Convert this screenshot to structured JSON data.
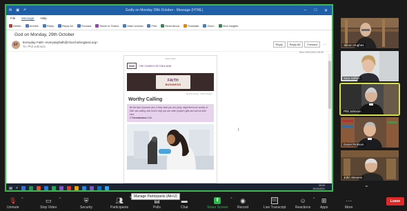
{
  "outlook": {
    "title": "Godly on Monday 29th October - Message (HTML)",
    "menu": [
      "File",
      "Message",
      "Help"
    ],
    "active_menu": "Message",
    "ribbon": [
      "Delete",
      "Archive",
      "Reply",
      "Reply All",
      "Forward",
      "Share to Teams",
      "Mark Unread",
      "Find",
      "Read Aloud",
      "Translate",
      "Zoom",
      "Viva Insights"
    ],
    "subject": "God on Monday, 29th October",
    "sender": {
      "initials": "EF",
      "name": "Everyday Faith <everydayfaith@churchofengland.org>",
      "to": "To: Phil Johnson"
    },
    "reply_buttons": [
      "Reply",
      "Reply All",
      "Forward"
    ],
    "date": "Mon 29/10/2021 06:00"
  },
  "newsletter": {
    "top": "View online",
    "logo_small": "faith",
    "logo_org": "THE CHURCH OF ENGLAND",
    "banner": {
      "line1": "FAITH",
      "line2": "BUSINESS"
    },
    "meta": "By Eve Poole · 29th October",
    "heading": "Worthy Calling",
    "purple_text": "Be the kind of person who, if they meet you at a party, might feel more worthy of their own calling. Ask God to help you see other people's gifts and call out their best.",
    "verse": "1 Thessalonians 1:11"
  },
  "cursor_mark": "I",
  "taskbar": {
    "clock_time": "06:00",
    "clock_date": "29/10/2021",
    "icon_colors": [
      "#3c6ecf",
      "#2e8b57",
      "#e05030",
      "#2b7bd4",
      "#23a455",
      "#8552c7",
      "#d83b3b",
      "#f0a000",
      "#1e88e5",
      "#7a56c8",
      "#0b6fc2",
      "#2ea3f2"
    ]
  },
  "participants": [
    {
      "name": "Simon Hughes",
      "active": false
    },
    {
      "name": "Sara Sefton",
      "active": false
    },
    {
      "name": "Phil Johnson",
      "active": true
    },
    {
      "name": "Daniel Robson",
      "active": false
    },
    {
      "name": "John Stevens",
      "active": false
    }
  ],
  "toolbar": {
    "items": [
      {
        "label": "Unmute",
        "icon": "microphone-icon"
      },
      {
        "label": "Stop Video",
        "icon": "video-icon"
      },
      {
        "label": "Security",
        "icon": "shield-icon"
      },
      {
        "label": "Participants",
        "icon": "participants-icon",
        "count": "5"
      },
      {
        "label": "Polls",
        "icon": "polls-icon"
      },
      {
        "label": "Chat",
        "icon": "chat-icon"
      },
      {
        "label": "Share Screen",
        "icon": "share-screen-icon"
      },
      {
        "label": "Record",
        "icon": "record-icon"
      },
      {
        "label": "Live Transcript",
        "icon": "cc-icon"
      },
      {
        "label": "Reactions",
        "icon": "reaction-icon"
      },
      {
        "label": "Apps",
        "icon": "apps-icon"
      },
      {
        "label": "More",
        "icon": "more-icon"
      }
    ],
    "tooltip": "Manage Participants (Alt+U)",
    "leave": "Leave"
  },
  "colors": {
    "share_border": "#3fb950",
    "active_speaker": "#d6e04a",
    "leave": "#e02828",
    "outlook_blue": "#1f5fa8",
    "newsletter_purple": "#e7d4ec"
  }
}
